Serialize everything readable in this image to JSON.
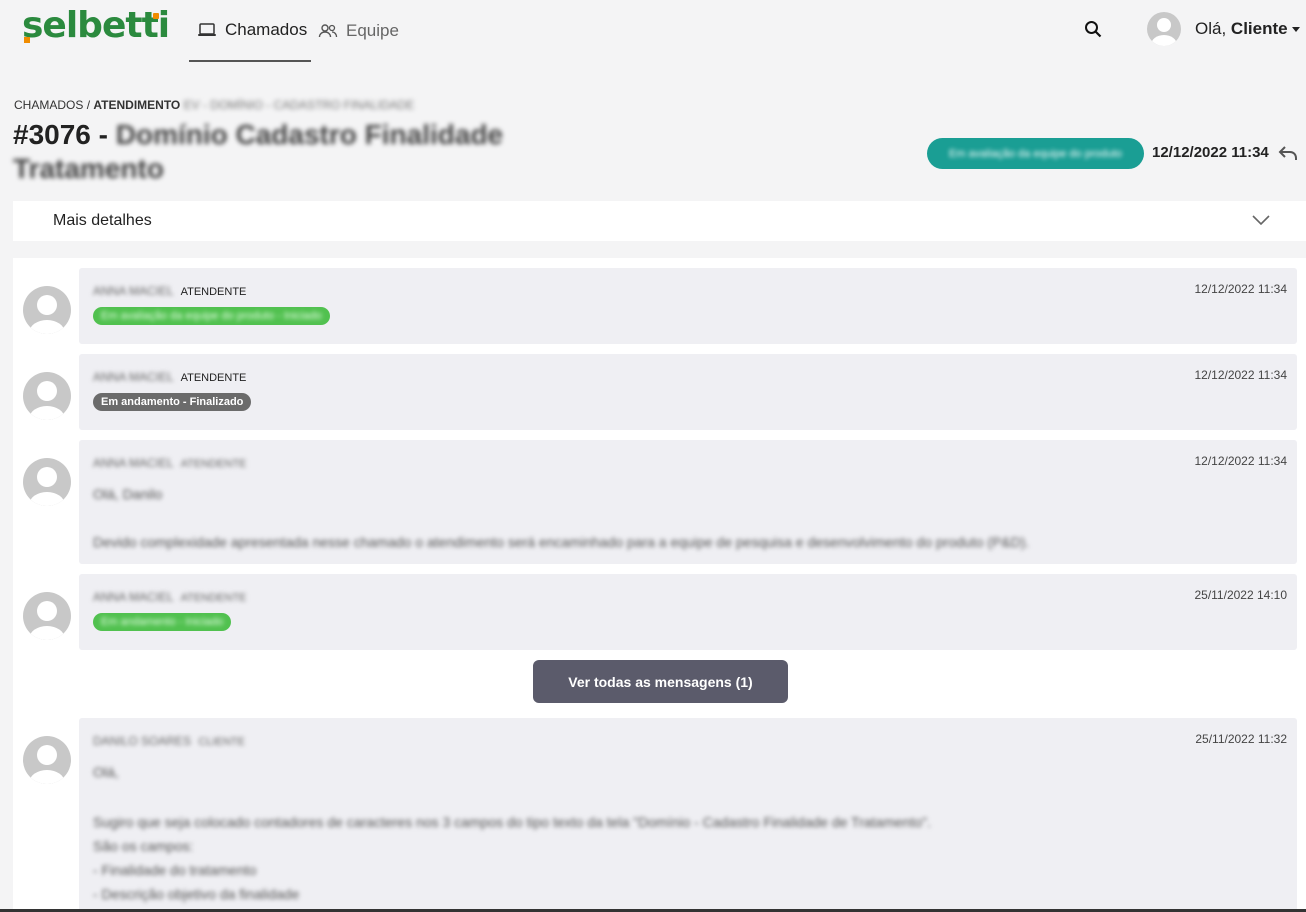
{
  "app": {
    "logo_text": "selbetti",
    "nav": [
      {
        "label": "Chamados",
        "active": true
      },
      {
        "label": "Equipe",
        "active": false
      }
    ],
    "greeting_prefix": "Olá,",
    "user_name": "Cliente"
  },
  "breadcrumb": {
    "root": "CHAMADOS",
    "sep": "/",
    "current": "ATENDIMENTO",
    "detail": "EV - DOMÍNIO - CADASTRO FINALIDADE"
  },
  "ticket": {
    "number": "#3076 -",
    "title_rest": "Domínio Cadastro Finalidade Tratamento",
    "status": "Em avaliação da equipe do produto",
    "date": "12/12/2022 11:34"
  },
  "details": {
    "label": "Mais detalhes"
  },
  "messages": [
    {
      "author": "ANNA MACIEL",
      "role": "ATENDENTE",
      "date": "12/12/2022 11:34",
      "badge": "Em avaliação da equipe do produto - Iniciado",
      "badge_color": "#51c14f"
    },
    {
      "author": "ANNA MACIEL",
      "role": "ATENDENTE",
      "date": "12/12/2022 11:34",
      "badge": "Em andamento - Finalizado",
      "badge_color": "#6b6b6b"
    },
    {
      "author": "ANNA MACIEL",
      "role": "ATENDENTE",
      "date": "12/12/2022 11:34",
      "line1": "Olá, Danilo",
      "line2": "Devido complexidade apresentada nesse chamado o atendimento será encaminhado para a equipe de pesquisa e desenvolvimento do produto (P&D)."
    },
    {
      "author": "ANNA MACIEL",
      "role": "ATENDENTE",
      "date": "25/11/2022 14:10",
      "badge": "Em andamento - Iniciado",
      "badge_color": "#51c14f"
    },
    {
      "author": "DANILO SOARES",
      "role": "CLIENTE",
      "date": "25/11/2022 11:32",
      "line1": "Olá,",
      "line2": "Sugiro que seja colocado contadores de caracteres nos 3 campos do tipo texto da tela \"Domínio - Cadastro Finalidade de Tratamento\".",
      "line3": "São os campos:",
      "line4": "- Finalidade do tratamento",
      "line5": "- Descrição objetivo da finalidade"
    }
  ],
  "view_all_label": "Ver todas as mensagens (1)"
}
